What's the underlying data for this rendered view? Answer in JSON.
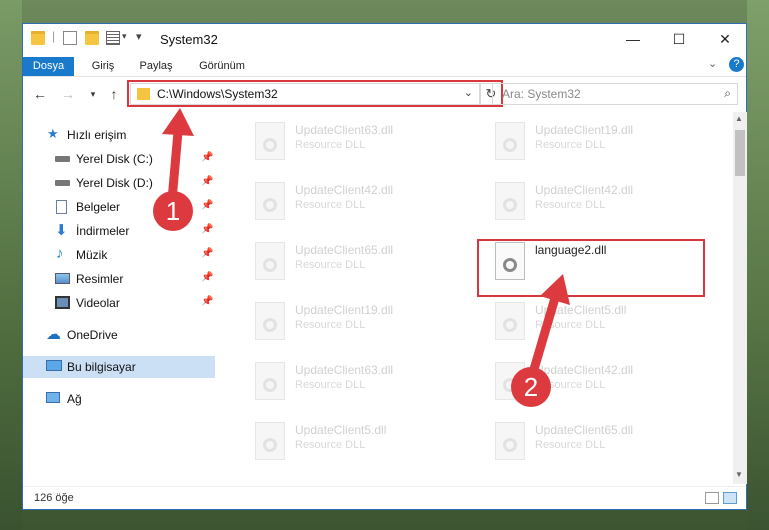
{
  "window": {
    "title": "System32",
    "tabs": [
      "Dosya",
      "Giriş",
      "Paylaş",
      "Görünüm"
    ],
    "address": "C:\\Windows\\System32",
    "search_placeholder": "Ara: System32",
    "status": "126 öğe"
  },
  "sidebar": {
    "items": [
      {
        "label": "Hızlı erişim",
        "icon": "star-icon"
      },
      {
        "label": "Yerel Disk (C:)",
        "icon": "drive-icon"
      },
      {
        "label": "Yerel Disk (D:)",
        "icon": "drive-icon"
      },
      {
        "label": "Belgeler",
        "icon": "documents-icon"
      },
      {
        "label": "İndirmeler",
        "icon": "download-icon"
      },
      {
        "label": "Müzik",
        "icon": "music-icon"
      },
      {
        "label": "Resimler",
        "icon": "pictures-icon"
      },
      {
        "label": "Videolar",
        "icon": "videos-icon"
      },
      {
        "label": "OneDrive",
        "icon": "cloud-icon"
      },
      {
        "label": "Bu bilgisayar",
        "icon": "computer-icon"
      },
      {
        "label": "Ağ",
        "icon": "network-icon"
      }
    ]
  },
  "files": [
    {
      "name": "UpdateClient63.dll",
      "desc": "Resource DLL"
    },
    {
      "name": "UpdateClient19.dll",
      "desc": "Resource DLL"
    },
    {
      "name": "UpdateClient42.dll",
      "desc": "Resource DLL"
    },
    {
      "name": "UpdateClient42.dll",
      "desc": "Resource DLL"
    },
    {
      "name": "UpdateClient65.dll",
      "desc": "Resource DLL"
    },
    {
      "name": "language2.dll",
      "desc": ""
    },
    {
      "name": "UpdateClient19.dll",
      "desc": "Resource DLL"
    },
    {
      "name": "UpdateClient5.dll",
      "desc": "Resource DLL"
    },
    {
      "name": "UpdateClient63.dll",
      "desc": "Resource DLL"
    },
    {
      "name": "UpdateClient42.dll",
      "desc": "Resource DLL"
    },
    {
      "name": "UpdateClient5.dll",
      "desc": "Resource DLL"
    },
    {
      "name": "UpdateClient65.dll",
      "desc": "Resource DLL"
    }
  ],
  "callouts": [
    "1",
    "2"
  ],
  "colors": {
    "accent": "#1979ca",
    "highlight": "#d9363e",
    "selected": "#cce0f5"
  }
}
